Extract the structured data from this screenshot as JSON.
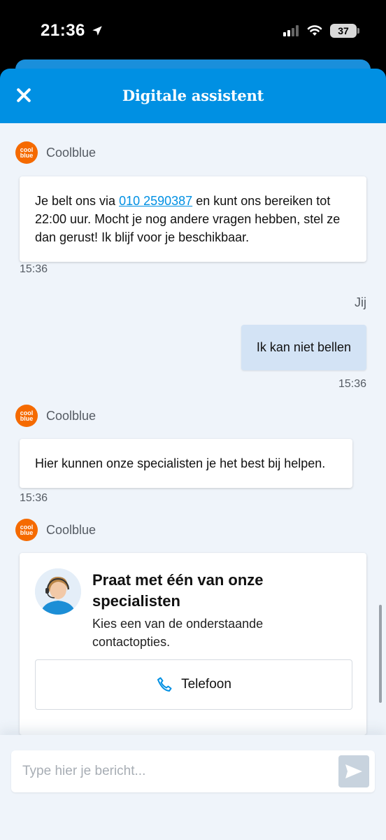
{
  "status_bar": {
    "time": "21:36",
    "battery": "37"
  },
  "header": {
    "title": "Digitale assistent"
  },
  "messages": [
    {
      "sender": "Coolblue",
      "text_before": "Je belt ons via ",
      "phone": "010 2590387",
      "text_after": " en kunt ons bereiken tot 22:00 uur. Mocht je nog andere vragen hebben, stel ze dan gerust! Ik blijf voor je beschikbaar.",
      "time": "15:36"
    },
    {
      "sender": "Jij",
      "text": "Ik kan niet bellen",
      "time": "15:36"
    },
    {
      "sender": "Coolblue",
      "text": "Hier kunnen onze specialisten je het best bij helpen.",
      "time": "15:36"
    },
    {
      "sender": "Coolblue"
    }
  ],
  "logo": {
    "line1": "cool",
    "line2": "blue"
  },
  "contact_card": {
    "title": "Praat met één van onze specialisten",
    "subtitle": "Kies een van de onderstaande contactopties.",
    "phone_button_label": "Telefoon",
    "icon": "phone-icon"
  },
  "composer": {
    "placeholder": "Type hier je bericht...",
    "send_icon": "send-icon"
  },
  "colors": {
    "brand_blue": "#0090e3",
    "coolblue_orange": "#f56a00",
    "user_bubble": "#d3e3f5"
  }
}
